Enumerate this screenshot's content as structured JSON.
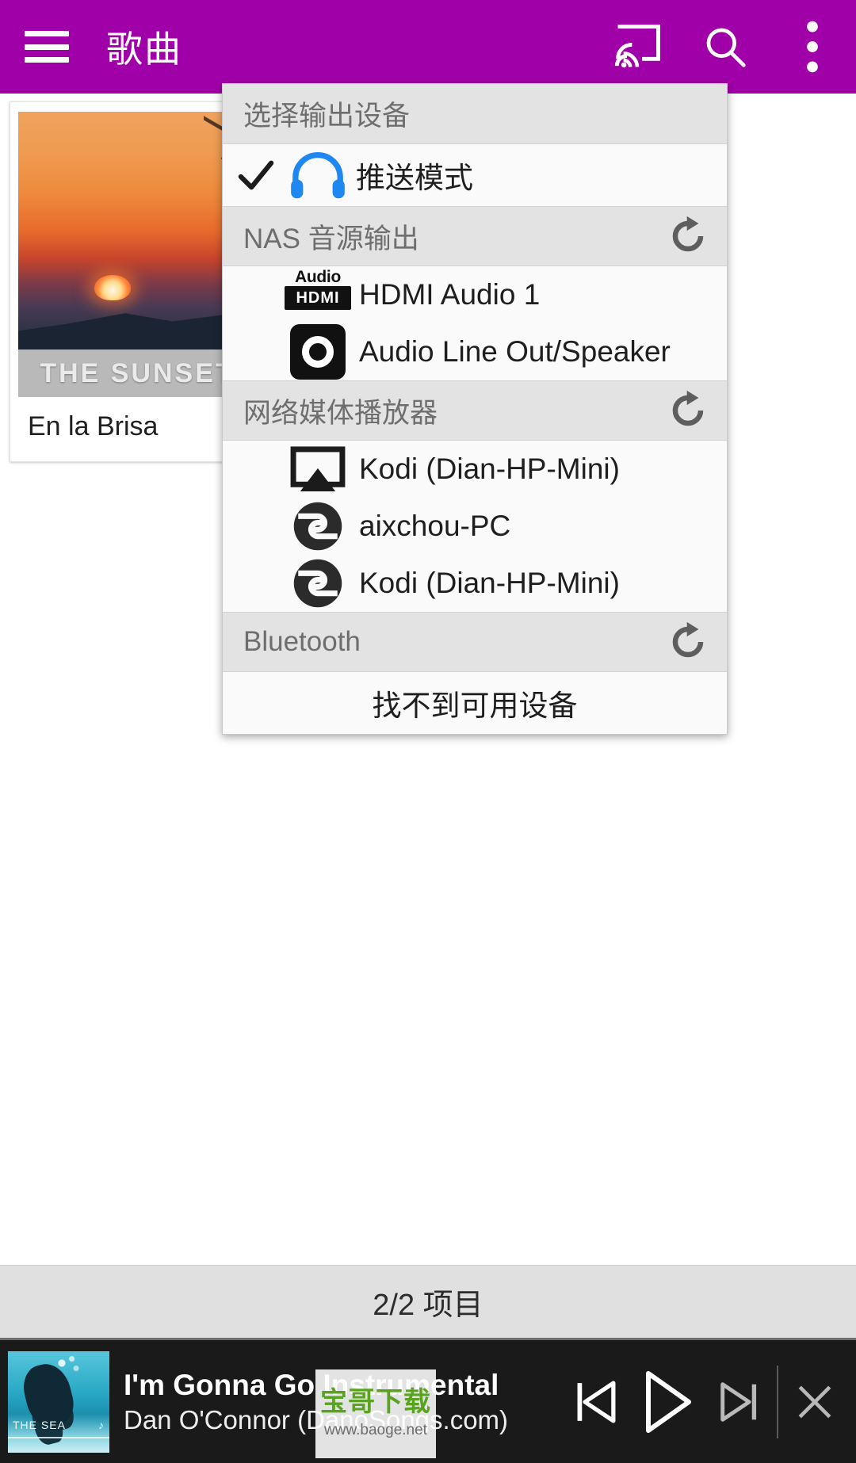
{
  "appbar": {
    "title": "歌曲",
    "menu_icon": "hamburger-icon",
    "cast_icon": "cast-icon",
    "search_icon": "search-icon",
    "overflow_icon": "more-vertical-icon"
  },
  "library": {
    "card": {
      "art_caption": "THE SUNSET",
      "title": "En la Brisa"
    },
    "count_text": "2/2 项目"
  },
  "popup": {
    "title": "选择输出设备",
    "sections": [
      {
        "id": "current",
        "header": null,
        "items": [
          {
            "label": "推送模式",
            "icon": "headphones-icon",
            "checked": true
          }
        ]
      },
      {
        "id": "nas",
        "header": "NAS 音源输出",
        "refresh_icon": "refresh-icon",
        "items": [
          {
            "label": "HDMI Audio 1",
            "icon": "hdmi-audio-icon",
            "checked": false
          },
          {
            "label": "Audio Line Out/Speaker",
            "icon": "line-out-icon",
            "checked": false
          }
        ]
      },
      {
        "id": "network",
        "header": "网络媒体播放器",
        "refresh_icon": "refresh-icon",
        "items": [
          {
            "label": "Kodi (Dian-HP-Mini)",
            "icon": "cast-screen-icon",
            "checked": false
          },
          {
            "label": "aixchou-PC",
            "icon": "dlna-icon",
            "checked": false
          },
          {
            "label": "Kodi (Dian-HP-Mini)",
            "icon": "dlna-icon",
            "checked": false
          }
        ]
      },
      {
        "id": "bluetooth",
        "header": "Bluetooth",
        "refresh_icon": "refresh-icon",
        "empty_text": "找不到可用设备",
        "items": []
      }
    ]
  },
  "player": {
    "album_caption": "THE SEA",
    "album_note": "♪",
    "title": "I'm Gonna Go Instrumental",
    "artist": "Dan O'Connor (DanoSongs.com)",
    "prev_icon": "skip-previous-icon",
    "play_icon": "play-icon",
    "next_icon": "skip-next-icon",
    "close_icon": "close-icon"
  },
  "watermark": {
    "main": "宝哥下载",
    "sub": "www.baoge.net"
  },
  "colors": {
    "brand_purple": "#a000a8",
    "menu_bg": "#fafafa",
    "section_bg": "#e3e3e3",
    "player_bg": "#1a1a1a",
    "headphones_blue": "#1e88f0"
  }
}
